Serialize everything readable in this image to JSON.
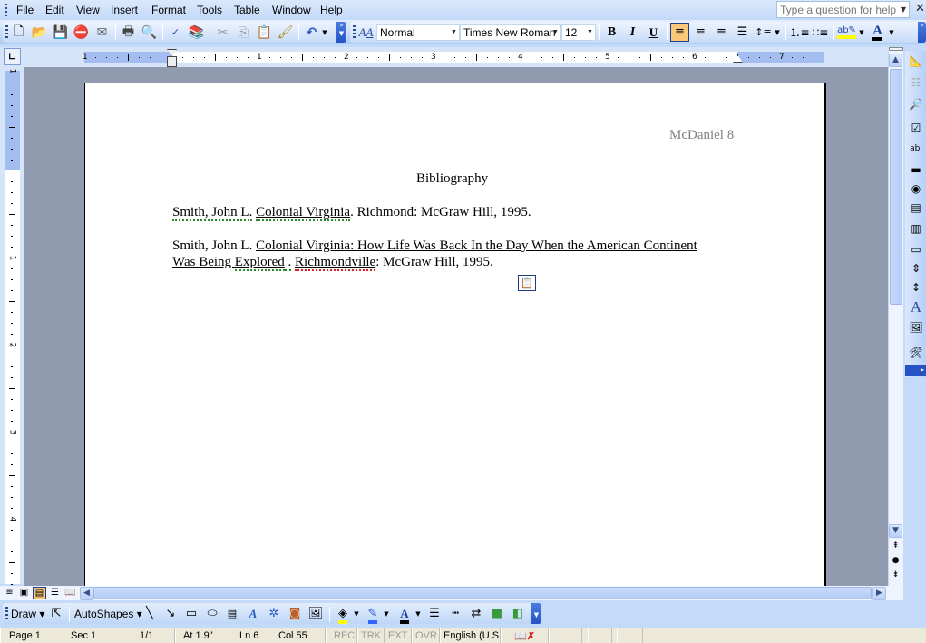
{
  "menubar": {
    "items": [
      "File",
      "Edit",
      "View",
      "Insert",
      "Format",
      "Tools",
      "Table",
      "Window",
      "Help"
    ],
    "help_placeholder": "Type a question for help"
  },
  "toolbar": {
    "standard": [
      "new-document",
      "open",
      "save",
      "permission",
      "email",
      "print",
      "print-preview",
      "spelling-grammar",
      "research",
      "cut",
      "copy",
      "paste",
      "format-painter",
      "undo"
    ],
    "style_value": "Normal",
    "font_value": "Times New Roman",
    "size_value": "12",
    "bold": "B",
    "italic": "I",
    "underline": "U",
    "alignment_active": "align-left",
    "highlight_color": "#ffff00",
    "font_color": "#000000"
  },
  "ruler": {
    "h_labels": [
      "1",
      "1",
      "2",
      "3",
      "4",
      "5",
      "6",
      "7"
    ],
    "v_labels": [
      "1",
      "1",
      "2",
      "3",
      "4"
    ]
  },
  "document": {
    "header": "McDaniel 8",
    "title": "Bibliography",
    "entry1": {
      "author": "Smith, John L.",
      "title": "Colonial Virginia",
      "rest": ". Richmond: McGraw Hill, 1995."
    },
    "entry2": {
      "author": "Smith, John L.",
      "title_line1": "Colonial Virginia: How Life Was Back In the Day When the American Continent",
      "title_line2a": "Was Being ",
      "title_line2b": "Explored",
      "title_line2c": " .",
      "city": "Richmondville",
      "rest": ": McGraw Hill, 1995."
    }
  },
  "drawing_toolbar": {
    "draw_label": "Draw",
    "autoshapes_label": "AutoShapes",
    "fill_color": "#ffff00",
    "line_color": "#3366ff",
    "font_color": "#000000"
  },
  "statusbar": {
    "page": "Page 1",
    "sec": "Sec 1",
    "pages": "1/1",
    "at": "At 1.9\"",
    "ln": "Ln 6",
    "col": "Col 55",
    "rec": "REC",
    "trk": "TRK",
    "ext": "EXT",
    "ovr": "OVR",
    "language": "English (U.S"
  }
}
